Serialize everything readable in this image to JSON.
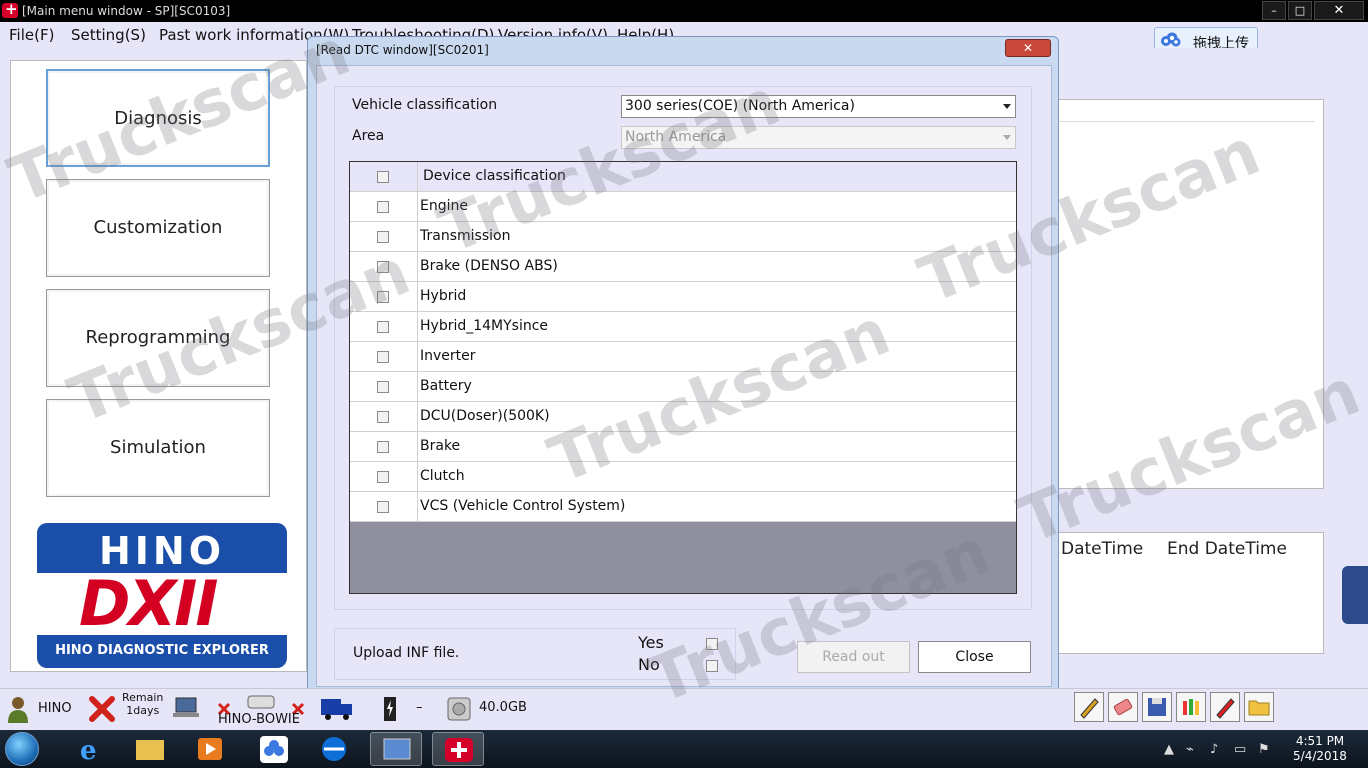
{
  "main_window": {
    "title": "[Main menu window - SP][SC0103]",
    "controls": {
      "minimize": "–",
      "maximize": "□",
      "close": "✕"
    }
  },
  "menu": {
    "file": "File(F)",
    "setting": "Setting(S)",
    "past_work": "Past work information(W)",
    "troubleshooting": "Troubleshooting(D)",
    "version": "Version info(V)",
    "help": "Help(H)"
  },
  "upload_button": {
    "label": "拖拽上传"
  },
  "left_menu": {
    "diagnosis": "Diagnosis",
    "customization": "Customization",
    "reprogramming": "Reprogramming",
    "simulation": "Simulation"
  },
  "logo": {
    "brand": "HINO",
    "product": "DXII",
    "caption": "HINO DIAGNOSTIC EXPLORER"
  },
  "right_lower": {
    "col_start": "DateTime",
    "col_end": "End DateTime"
  },
  "dialog": {
    "title": "[Read DTC window][SC0201]",
    "close_x": "✕",
    "vehicle_label": "Vehicle classification",
    "vehicle_value": "300 series(COE) (North America)",
    "area_label": "Area",
    "area_value": "North America",
    "table_header": "Device classification",
    "devices": [
      "Engine",
      "Transmission",
      "Brake (DENSO ABS)",
      "Hybrid",
      "Hybrid_14MYsince",
      "Inverter",
      "Battery",
      "DCU(Doser)(500K)",
      "Brake",
      "Clutch",
      "VCS (Vehicle Control System)"
    ],
    "upload_label": "Upload INF file.",
    "yes": "Yes",
    "no": "No",
    "read_out": "Read out",
    "close": "Close"
  },
  "statusbar": {
    "user": "HINO",
    "remain_line1": "Remain",
    "remain_line2": "1days",
    "device": "HINO-BOWIE",
    "dash": "–",
    "disk": "40.0GB"
  },
  "taskbar": {
    "time": "4:51 PM",
    "date": "5/4/2018"
  },
  "watermark": "Truckscan",
  "colors": {
    "client_bg": "#e6e6f8",
    "dialog_frame": "#c9d9ef",
    "hino_red": "#d40021",
    "hino_blue": "#1a4ea8"
  }
}
